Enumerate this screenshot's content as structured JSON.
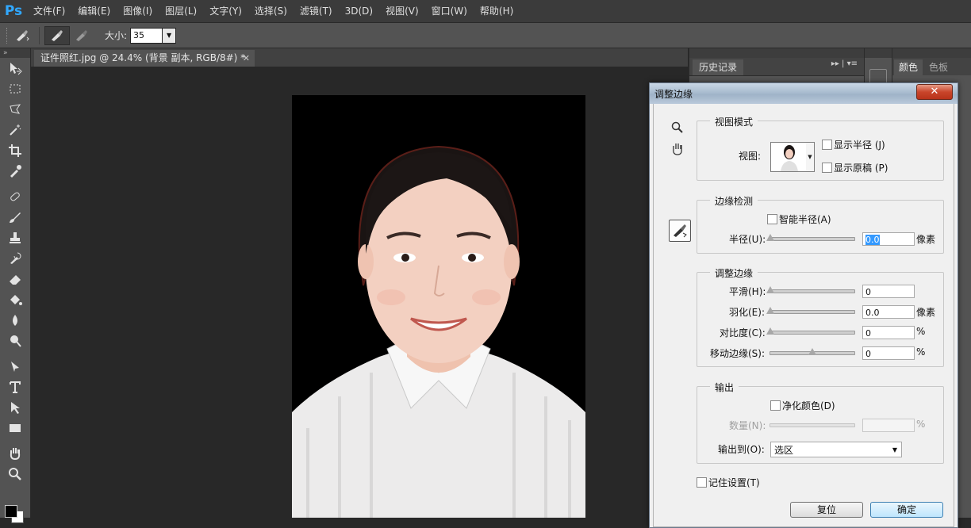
{
  "app": {
    "logo": "Ps"
  },
  "menu": [
    "文件(F)",
    "编辑(E)",
    "图像(I)",
    "图层(L)",
    "文字(Y)",
    "选择(S)",
    "滤镜(T)",
    "3D(D)",
    "视图(V)",
    "窗口(W)",
    "帮助(H)"
  ],
  "options_bar": {
    "size_label": "大小:",
    "size_value": "35"
  },
  "toolbar": {
    "tools": [
      "move-icon",
      "marquee-icon",
      "lasso-icon",
      "magic-wand-icon",
      "crop-icon",
      "eyedropper-icon",
      "healing-brush-icon",
      "brush-icon",
      "clone-stamp-icon",
      "history-brush-icon",
      "eraser-icon",
      "paint-bucket-icon",
      "blur-icon",
      "dodge-icon",
      "pen-icon",
      "type-icon",
      "path-select-icon",
      "rectangle-icon",
      "hand-icon",
      "zoom-icon"
    ],
    "foreground_color": "#000000",
    "background_color": "#ffffff"
  },
  "document": {
    "tab_title": "证件照红.jpg @ 24.4% (背景 副本, RGB/8#) *"
  },
  "panels": {
    "history_tab": "历史记录",
    "color_tab": "颜色",
    "swatches_tab": "色板"
  },
  "dialog": {
    "title": "调整边缘",
    "view_mode": {
      "group_title": "视图模式",
      "view_label": "视图:",
      "show_radius": "显示半径 (J)",
      "show_original": "显示原稿 (P)"
    },
    "edge_detection": {
      "group_title": "边缘检测",
      "smart_radius": "智能半径(A)",
      "radius_label": "半径(U):",
      "radius_value": "0.0",
      "radius_unit": "像素"
    },
    "adjust_edge": {
      "group_title": "调整边缘",
      "smooth_label": "平滑(H):",
      "smooth_value": "0",
      "feather_label": "羽化(E):",
      "feather_value": "0.0",
      "feather_unit": "像素",
      "contrast_label": "对比度(C):",
      "contrast_value": "0",
      "contrast_unit": "%",
      "shift_label": "移动边缘(S):",
      "shift_value": "0",
      "shift_unit": "%"
    },
    "output": {
      "group_title": "输出",
      "decontaminate": "净化颜色(D)",
      "amount_label": "数量(N):",
      "amount_unit": "%",
      "output_to_label": "输出到(O):",
      "output_to_value": "选区"
    },
    "remember": "记住设置(T)",
    "reset_button": "复位",
    "ok_button": "确定"
  }
}
